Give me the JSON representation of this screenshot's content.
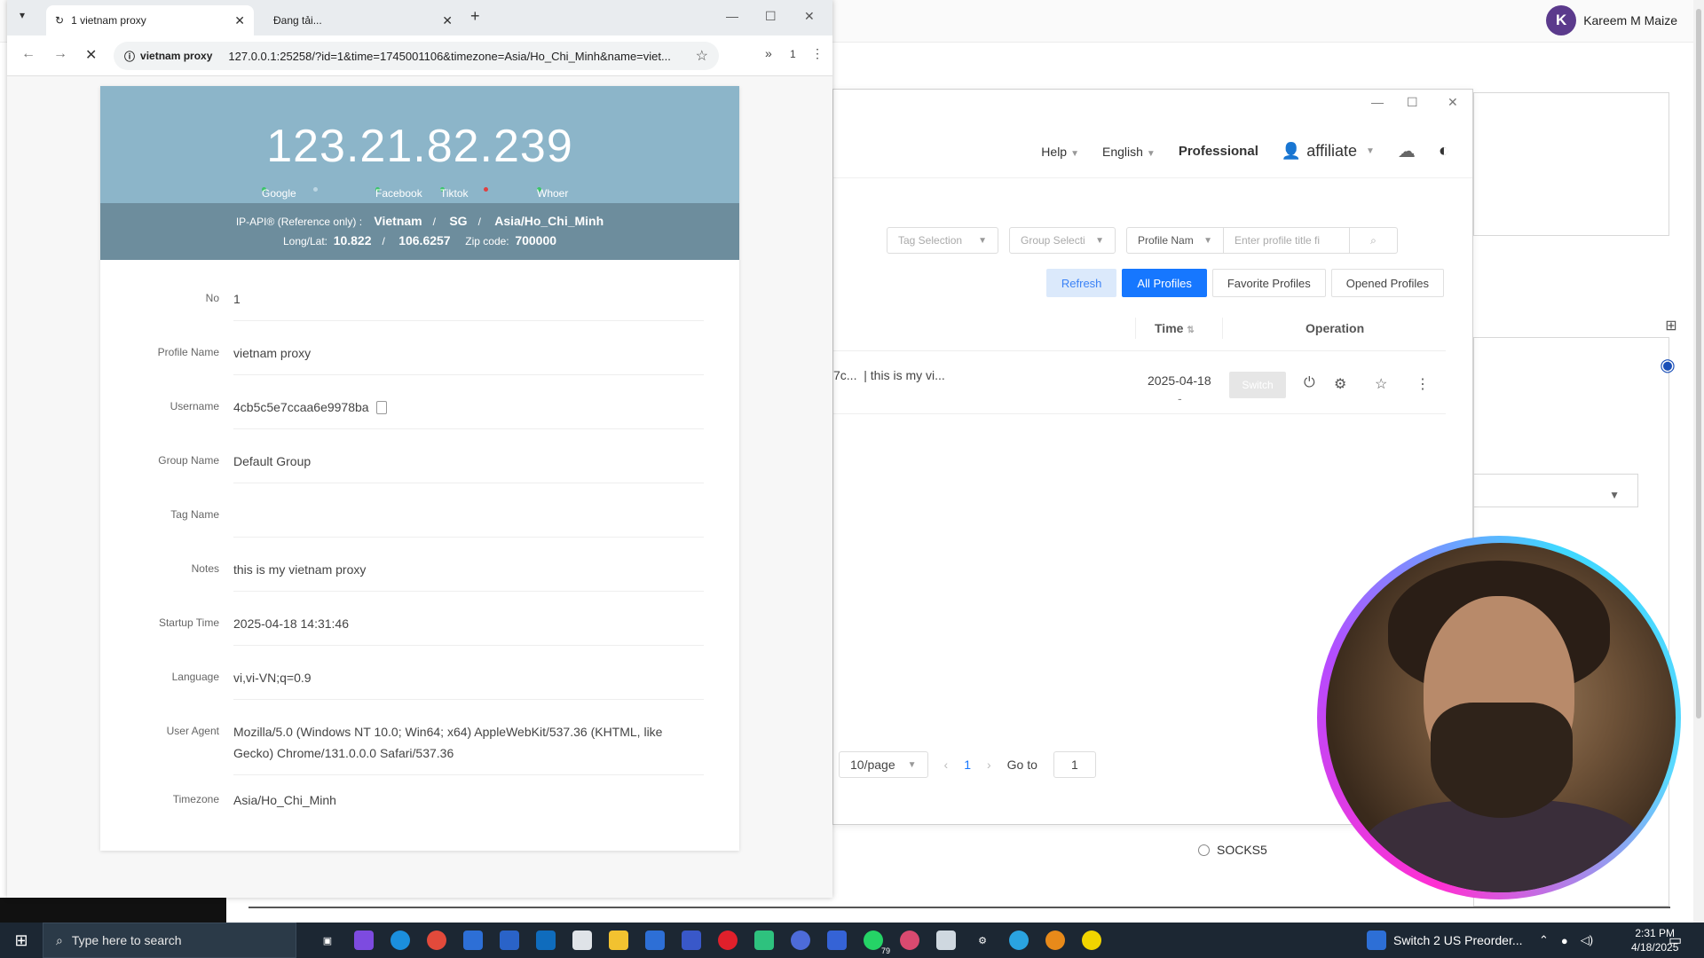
{
  "background": {
    "user_initial": "K",
    "user_name": "Kareem M Maize",
    "socks_label": "SOCKS5"
  },
  "app": {
    "header": {
      "help": "Help",
      "language": "English",
      "plan": "Professional",
      "account": "affiliate"
    },
    "filters": {
      "tag": "Tag Selection",
      "group": "Group Selecti",
      "profile_field": "Profile Nam",
      "search_placeholder": "Enter profile title fi"
    },
    "tabs": {
      "refresh": "Refresh",
      "all": "All Profiles",
      "favorite": "Favorite Profiles",
      "opened": "Opened Profiles"
    },
    "table": {
      "col_time": "Time",
      "col_operation": "Operation",
      "row": {
        "prefix": "7c...",
        "note": "| this is my vi...",
        "date": "2025-04-18",
        "dash": "-",
        "switch": "Switch"
      }
    },
    "pagination": {
      "per_page": "10/page",
      "current": "1",
      "goto_label": "Go to",
      "goto_value": "1"
    }
  },
  "browser": {
    "tabs": [
      {
        "title": "1 vietnam proxy"
      },
      {
        "title": "Đang tải..."
      }
    ],
    "site_chip": "vietnam proxy",
    "url": "127.0.0.1:25258/?id=1&time=1745001106&timezone=Asia/Ho_Chi_Minh&name=viet...",
    "ext_count": "1"
  },
  "page": {
    "ip": "123.21.82.239",
    "checks": {
      "google": "Google",
      "facebook": "Facebook",
      "tiktok": "Tiktok",
      "whoer": "Whoer"
    },
    "geo": {
      "source": "IP-API® (Reference only) :",
      "country": "Vietnam",
      "region": "SG",
      "timezone": "Asia/Ho_Chi_Minh",
      "longlat_label": "Long/Lat:",
      "lat": "10.822",
      "lon": "106.6257",
      "zip_label": "Zip code:",
      "zip": "700000"
    },
    "details": {
      "no_label": "No",
      "no": "1",
      "profile_label": "Profile Name",
      "profile": "vietnam proxy",
      "username_label": "Username",
      "username": "4cb5c5e7ccaa6e9978ba",
      "group_label": "Group Name",
      "group": "Default Group",
      "tag_label": "Tag Name",
      "tag": "",
      "notes_label": "Notes",
      "notes": "this is my vietnam proxy",
      "startup_label": "Startup Time",
      "startup": "2025-04-18 14:31:46",
      "language_label": "Language",
      "language": "vi,vi-VN;q=0.9",
      "ua_label": "User Agent",
      "ua": "Mozilla/5.0 (Windows NT 10.0; Win64; x64) AppleWebKit/537.36 (KHTML, like Gecko) Chrome/131.0.0.0 Safari/537.36",
      "tz_label": "Timezone",
      "tz": "Asia/Ho_Chi_Minh"
    }
  },
  "taskbar": {
    "search_placeholder": "Type here to search",
    "whatsapp_badge": "79",
    "news": "Switch 2 US Preorder...",
    "time": "2:31 PM",
    "date": "4/18/2025"
  },
  "colors": {
    "ip_header": "#8cb5c9",
    "geo_band": "#6d8d9d",
    "primary_blue": "#1677ff",
    "taskbar": "#1c2733"
  }
}
